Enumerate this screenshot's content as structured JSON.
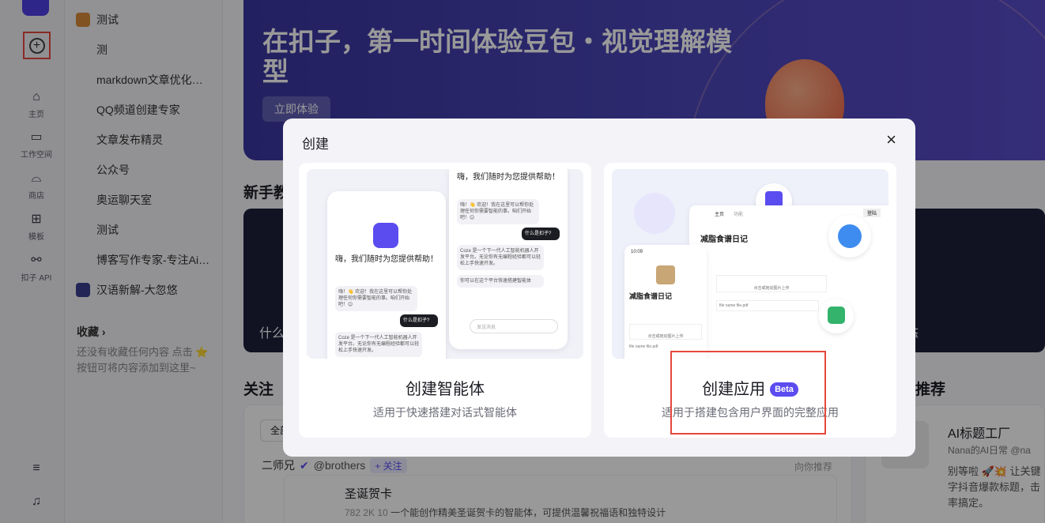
{
  "rail": {
    "nav": [
      {
        "label": "主页",
        "icon": "home-icon"
      },
      {
        "label": "工作空间",
        "icon": "workspace-icon"
      },
      {
        "label": "商店",
        "icon": "store-icon"
      },
      {
        "label": "模板",
        "icon": "template-icon"
      },
      {
        "label": "扣子 API",
        "icon": "api-icon"
      }
    ]
  },
  "sidebar": {
    "items": [
      {
        "label": "测试"
      },
      {
        "label": "测"
      },
      {
        "label": "markdown文章优化…"
      },
      {
        "label": "QQ频道创建专家"
      },
      {
        "label": "文章发布精灵"
      },
      {
        "label": "公众号"
      },
      {
        "label": "奥运聊天室"
      },
      {
        "label": "测试"
      },
      {
        "label": "博客写作专家-专注Ai…"
      },
      {
        "label": "汉语新解-大忽悠"
      }
    ],
    "favorites_title": "收藏",
    "favorites_empty": "还没有收藏任何内容 点击 ⭐ 按钮可将内容添加到这里~"
  },
  "banner": {
    "title": "在扣子，第一时间体验豆包・视觉理解模型",
    "cta": "立即体验"
  },
  "sections": {
    "tutorial": "新手教",
    "follow": "关注",
    "recommend": "推荐"
  },
  "background_cards": {
    "left_text": "什么",
    "right_text": "动态"
  },
  "follow": {
    "filter": "全部",
    "author": "二师兄",
    "handle": "@brothers",
    "follow_btn": "+ 关注",
    "tag": "向你推荐",
    "post_title": "圣诞贺卡",
    "post_stats": "782   2K   10",
    "post_desc": "一个能创作精美圣诞贺卡的智能体，可提供温馨祝福语和独特设计"
  },
  "recommend": {
    "title": "AI标题工厂",
    "author": "Nana的AI日常 @na",
    "desc": "别等啦 🚀💥 让关键字抖音爆款标题，击率搞定。"
  },
  "modal": {
    "title": "创建",
    "close": "×",
    "options": [
      {
        "name": "创建智能体",
        "desc": "适用于快速搭建对话式智能体",
        "badge": ""
      },
      {
        "name": "创建应用",
        "desc": "适用于搭建包含用户界面的完整应用",
        "badge": "Beta"
      }
    ],
    "agent_preview": {
      "greeting": "嗨，我们随时为您提供帮助！",
      "msg1": "嗨！👋 欢迎！我在这里可以帮你处理任何你需要智能的事。咱们开始吧！😊",
      "q": "什么是扣子?",
      "msg2": "Coze 是一个下一代人工智能机器人开发平台。无论你有无编程经验都可以轻松上手快速开发。",
      "msg3": "你可以在这个平台快速搭建智能体",
      "input": "发送消息"
    },
    "app_preview": {
      "app_title": "减脂食谱日记",
      "tab_home": "主页",
      "tab_other": "功能",
      "login": "登陆",
      "time": "10:09",
      "upload": "点击或拖动图片上传",
      "file": "file name file.pdf"
    }
  }
}
